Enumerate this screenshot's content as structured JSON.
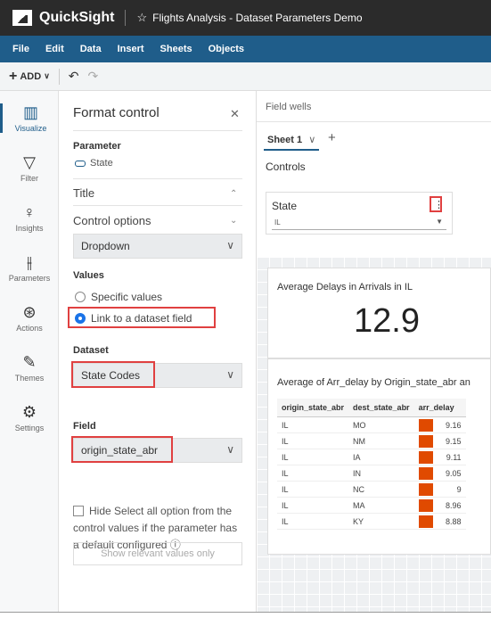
{
  "app": {
    "name": "QuickSight",
    "doc_title": "Flights Analysis - Dataset Parameters Demo"
  },
  "menu": [
    "File",
    "Edit",
    "Data",
    "Insert",
    "Sheets",
    "Objects"
  ],
  "toolbar": {
    "add_label": "ADD"
  },
  "nav": [
    {
      "label": "Visualize",
      "icon": "visualize-icon"
    },
    {
      "label": "Filter",
      "icon": "filter-icon"
    },
    {
      "label": "Insights",
      "icon": "insights-icon"
    },
    {
      "label": "Parameters",
      "icon": "parameters-icon"
    },
    {
      "label": "Actions",
      "icon": "actions-icon"
    },
    {
      "label": "Themes",
      "icon": "themes-icon"
    },
    {
      "label": "Settings",
      "icon": "settings-icon"
    }
  ],
  "panel": {
    "title": "Format control",
    "parameter_label": "Parameter",
    "parameter_value": "State",
    "title_section": "Title",
    "control_options_section": "Control options",
    "control_type": "Dropdown",
    "values_label": "Values",
    "radio_specific": "Specific values",
    "radio_link": "Link to a dataset field",
    "dataset_label": "Dataset",
    "dataset_value": "State Codes",
    "field_label": "Field",
    "field_value": "origin_state_abr",
    "hide_select_all": "Hide Select all option from the control values if the parameter has a default configured ⓘ",
    "show_relevant": "Show relevant values only"
  },
  "right": {
    "field_wells": "Field wells",
    "sheet_tab": "Sheet 1",
    "controls_label": "Controls",
    "control_name": "State",
    "control_value": "IL",
    "kpi_title": "Average Delays in Arrivals in IL",
    "kpi_value": "12.9",
    "table_title": "Average of Arr_delay by Origin_state_abr an",
    "columns": [
      "origin_state_abr",
      "dest_state_abr",
      "arr_delay"
    ],
    "rows": [
      [
        "IL",
        "MO",
        "9.16"
      ],
      [
        "IL",
        "NM",
        "9.15"
      ],
      [
        "IL",
        "IA",
        "9.11"
      ],
      [
        "IL",
        "IN",
        "9.05"
      ],
      [
        "IL",
        "NC",
        "9"
      ],
      [
        "IL",
        "MA",
        "8.96"
      ],
      [
        "IL",
        "KY",
        "8.88"
      ]
    ]
  },
  "colors": {
    "accent": "#1f5d8a",
    "bar": "#e04a00",
    "highlight": "#e04040"
  }
}
